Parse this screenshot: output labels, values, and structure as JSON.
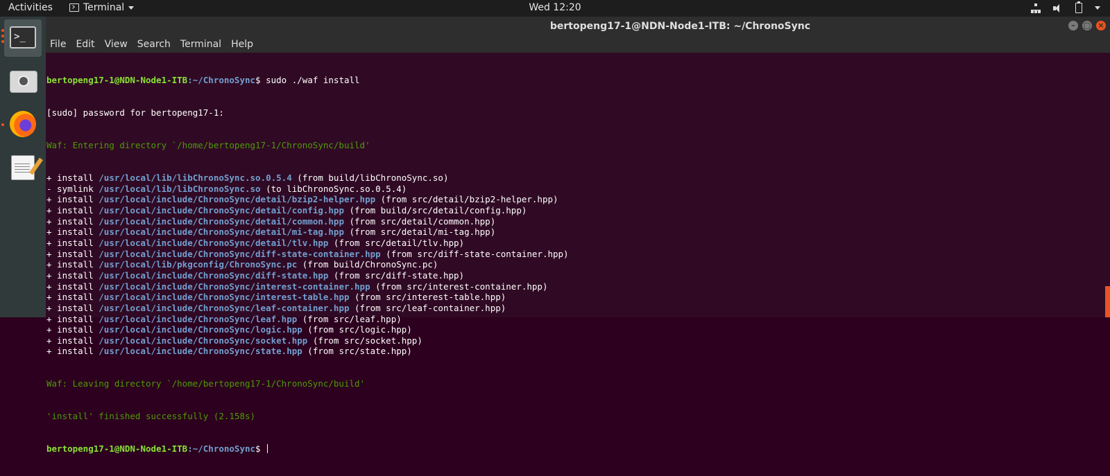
{
  "topbar": {
    "activities": "Activities",
    "app_name": "Terminal",
    "clock": "Wed 12:20",
    "tray_icons": [
      "network-icon",
      "volume-icon",
      "battery-icon",
      "power-menu-icon"
    ]
  },
  "dock": {
    "items": [
      "terminal-icon",
      "camera-icon",
      "firefox-icon",
      "text-editor-icon"
    ]
  },
  "window": {
    "title": "bertopeng17-1@NDN-Node1-ITB: ~/ChronoSync",
    "menu": [
      "File",
      "Edit",
      "View",
      "Search",
      "Terminal",
      "Help"
    ]
  },
  "terminal": {
    "prompt_user": "bertopeng17-1@NDN-Node1-ITB",
    "prompt_path": ":~/ChronoSync",
    "prompt_symbol": "$ ",
    "command": "sudo ./waf install",
    "sudo_prompt": "[sudo] password for bertopeng17-1:",
    "waf_enter": "Waf: Entering directory `/home/bertopeng17-1/ChronoSync/build'",
    "install_lines": [
      {
        "prefix": "+ install ",
        "path": "/usr/local/lib/libChronoSync.so.0.5.4",
        "suffix": " (from build/libChronoSync.so)"
      },
      {
        "prefix": "- symlink ",
        "path": "/usr/local/lib/libChronoSync.so",
        "suffix": " (to libChronoSync.so.0.5.4)"
      },
      {
        "prefix": "+ install ",
        "path": "/usr/local/include/ChronoSync/detail/bzip2-helper.hpp",
        "suffix": " (from src/detail/bzip2-helper.hpp)"
      },
      {
        "prefix": "+ install ",
        "path": "/usr/local/include/ChronoSync/detail/config.hpp",
        "suffix": " (from build/src/detail/config.hpp)"
      },
      {
        "prefix": "+ install ",
        "path": "/usr/local/include/ChronoSync/detail/common.hpp",
        "suffix": " (from src/detail/common.hpp)"
      },
      {
        "prefix": "+ install ",
        "path": "/usr/local/include/ChronoSync/detail/mi-tag.hpp",
        "suffix": " (from src/detail/mi-tag.hpp)"
      },
      {
        "prefix": "+ install ",
        "path": "/usr/local/include/ChronoSync/detail/tlv.hpp",
        "suffix": " (from src/detail/tlv.hpp)"
      },
      {
        "prefix": "+ install ",
        "path": "/usr/local/include/ChronoSync/diff-state-container.hpp",
        "suffix": " (from src/diff-state-container.hpp)"
      },
      {
        "prefix": "+ install ",
        "path": "/usr/local/lib/pkgconfig/ChronoSync.pc",
        "suffix": " (from build/ChronoSync.pc)"
      },
      {
        "prefix": "+ install ",
        "path": "/usr/local/include/ChronoSync/diff-state.hpp",
        "suffix": " (from src/diff-state.hpp)"
      },
      {
        "prefix": "+ install ",
        "path": "/usr/local/include/ChronoSync/interest-container.hpp",
        "suffix": " (from src/interest-container.hpp)"
      },
      {
        "prefix": "+ install ",
        "path": "/usr/local/include/ChronoSync/interest-table.hpp",
        "suffix": " (from src/interest-table.hpp)"
      },
      {
        "prefix": "+ install ",
        "path": "/usr/local/include/ChronoSync/leaf-container.hpp",
        "suffix": " (from src/leaf-container.hpp)"
      },
      {
        "prefix": "+ install ",
        "path": "/usr/local/include/ChronoSync/leaf.hpp",
        "suffix": " (from src/leaf.hpp)"
      },
      {
        "prefix": "+ install ",
        "path": "/usr/local/include/ChronoSync/logic.hpp",
        "suffix": " (from src/logic.hpp)"
      },
      {
        "prefix": "+ install ",
        "path": "/usr/local/include/ChronoSync/socket.hpp",
        "suffix": " (from src/socket.hpp)"
      },
      {
        "prefix": "+ install ",
        "path": "/usr/local/include/ChronoSync/state.hpp",
        "suffix": " (from src/state.hpp)"
      }
    ],
    "waf_leave": "Waf: Leaving directory `/home/bertopeng17-1/ChronoSync/build'",
    "finished": "'install' finished successfully (2.158s)"
  },
  "colors": {
    "terminal_bg": "#300a24",
    "prompt_user": "#8ae234",
    "path": "#729fcf",
    "waf_message": "#4e9a06",
    "accent": "#e95420"
  }
}
